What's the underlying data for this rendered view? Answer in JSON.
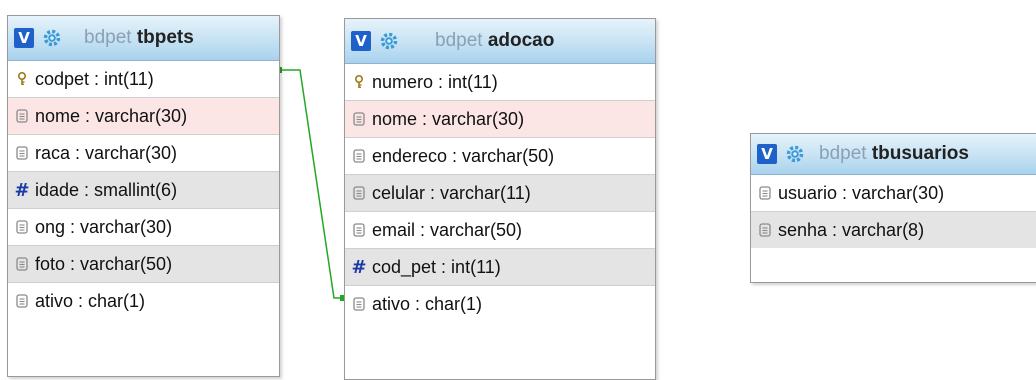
{
  "tables": [
    {
      "db": "bdpet",
      "name": "tbpets",
      "columns": [
        {
          "icon": "key",
          "text": "codpet : int(11)",
          "bg": "white"
        },
        {
          "icon": "field",
          "text": "nome : varchar(30)",
          "bg": "pink"
        },
        {
          "icon": "field",
          "text": "raca : varchar(30)",
          "bg": "white"
        },
        {
          "icon": "number",
          "text": "idade : smallint(6)",
          "bg": "gray"
        },
        {
          "icon": "field",
          "text": "ong : varchar(30)",
          "bg": "white"
        },
        {
          "icon": "field",
          "text": "foto : varchar(50)",
          "bg": "gray"
        },
        {
          "icon": "field",
          "text": "ativo : char(1)",
          "bg": "white"
        }
      ]
    },
    {
      "db": "bdpet",
      "name": "adocao",
      "columns": [
        {
          "icon": "key",
          "text": "numero : int(11)",
          "bg": "white"
        },
        {
          "icon": "field",
          "text": "nome : varchar(30)",
          "bg": "pink"
        },
        {
          "icon": "field",
          "text": "endereco : varchar(50)",
          "bg": "white"
        },
        {
          "icon": "field",
          "text": "celular : varchar(11)",
          "bg": "gray"
        },
        {
          "icon": "field",
          "text": "email : varchar(50)",
          "bg": "white"
        },
        {
          "icon": "number",
          "text": "cod_pet : int(11)",
          "bg": "gray"
        },
        {
          "icon": "field",
          "text": "ativo : char(1)",
          "bg": "white"
        }
      ]
    },
    {
      "db": "bdpet",
      "name": "tbusuarios",
      "columns": [
        {
          "icon": "field",
          "text": "usuario : varchar(30)",
          "bg": "white"
        },
        {
          "icon": "field",
          "text": "senha : varchar(8)",
          "bg": "gray"
        }
      ]
    }
  ],
  "toggle_label": "V",
  "relation_color": "#22a822"
}
